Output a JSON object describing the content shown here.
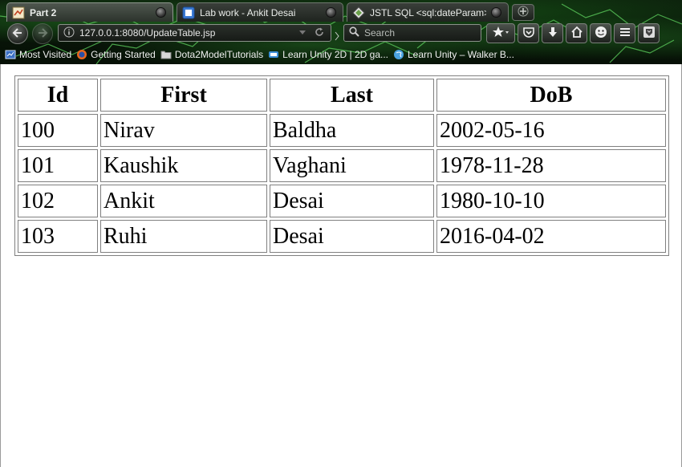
{
  "browser": {
    "tabs": [
      {
        "title": "Part 2",
        "active": true,
        "icon": "page-icon"
      },
      {
        "title": "Lab work - Ankit Desai",
        "active": false,
        "icon": "doc-icon"
      },
      {
        "title": "JSTL SQL <sql:dateParam> ...",
        "active": false,
        "icon": "tutorialspoint-icon"
      }
    ],
    "address": "127.0.0.1:8080/UpdateTable.jsp",
    "search_placeholder": "Search",
    "bookmarks": [
      {
        "label": "Most Visited",
        "icon": "most-visited-icon"
      },
      {
        "label": "Getting Started",
        "icon": "firefox-icon"
      },
      {
        "label": "Dota2ModelTutorials",
        "icon": "folder-icon"
      },
      {
        "label": "Learn Unity 2D | 2D ga...",
        "icon": "unity-icon"
      },
      {
        "label": "Learn Unity – Walker B...",
        "icon": "globe-icon"
      }
    ]
  },
  "table": {
    "headers": [
      "Id",
      "First",
      "Last",
      "DoB"
    ],
    "rows": [
      [
        "100",
        "Nirav",
        "Baldha",
        "2002-05-16"
      ],
      [
        "101",
        "Kaushik",
        "Vaghani",
        "1978-11-28"
      ],
      [
        "102",
        "Ankit",
        "Desai",
        "1980-10-10"
      ],
      [
        "103",
        "Ruhi",
        "Desai",
        "2016-04-02"
      ]
    ]
  }
}
